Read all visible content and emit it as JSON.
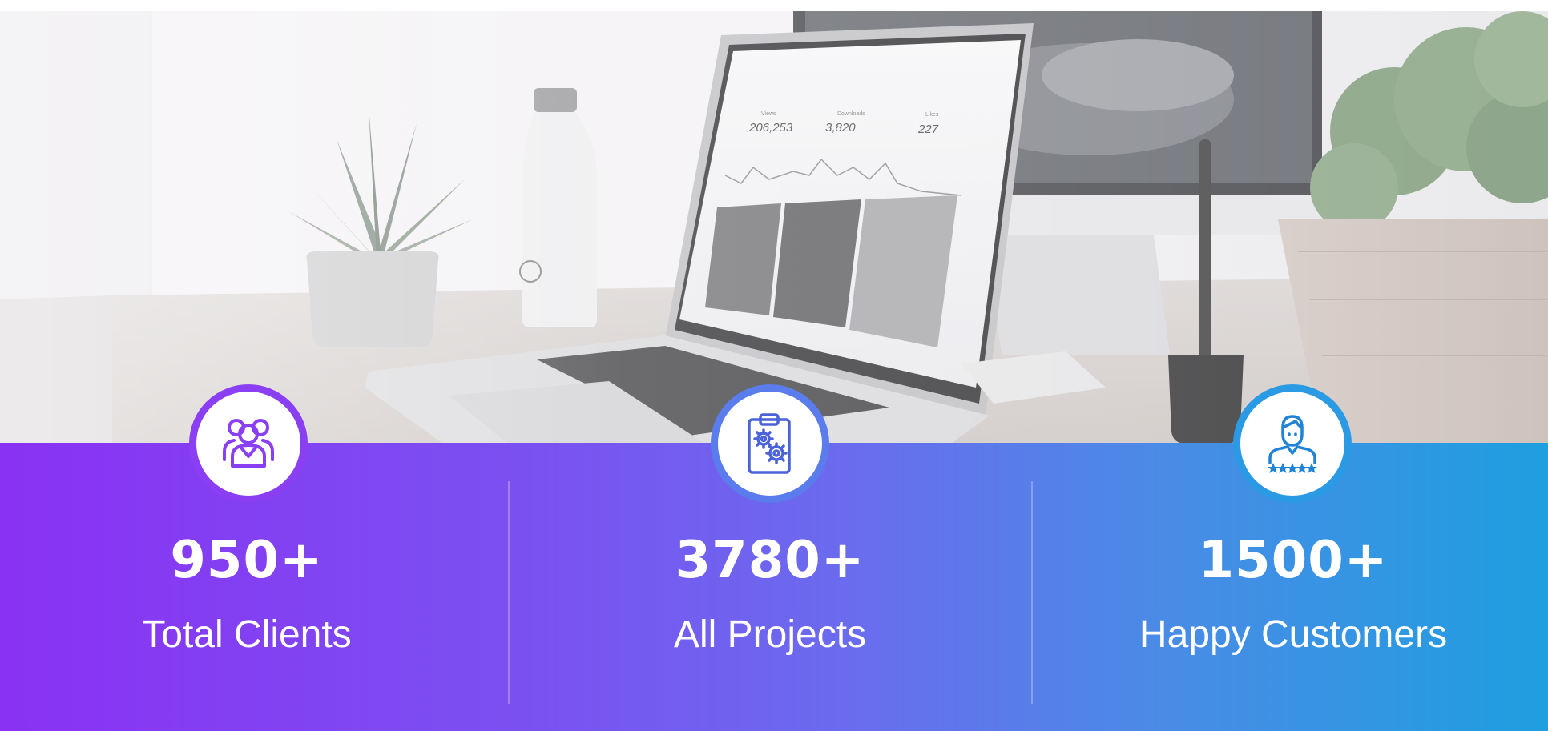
{
  "hero": {
    "image": "laptop-on-desk-photo",
    "screen_stats": [
      {
        "label": "Views",
        "value": "206,253"
      },
      {
        "label": "Downloads",
        "value": "3,820"
      },
      {
        "label": "Likes",
        "value": "227"
      }
    ]
  },
  "stats": [
    {
      "number": "950+",
      "label": "Total Clients",
      "icon": "group-users-icon",
      "ring_color": "#8a3ff2"
    },
    {
      "number": "3780+",
      "label": "All Projects",
      "icon": "clipboard-gears-icon",
      "ring_color": "#5a7cec"
    },
    {
      "number": "1500+",
      "label": "Happy Customers",
      "icon": "customer-star-rating-icon",
      "ring_color": "#2b9ae4"
    }
  ],
  "colors": {
    "gradient_start": "#8a31f3",
    "gradient_end": "#1e9fe0",
    "text": "#ffffff"
  }
}
